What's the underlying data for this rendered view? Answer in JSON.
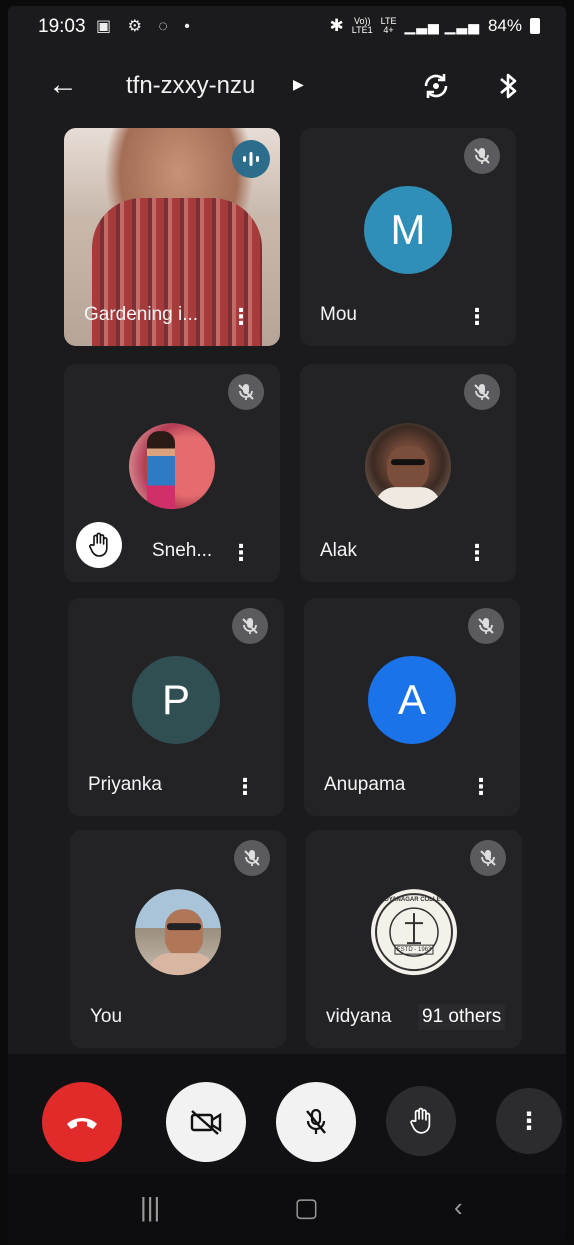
{
  "status_bar": {
    "time": "19:03",
    "net_top": "Vo))",
    "net_bottom": "LTE1",
    "lte_top": "LTE",
    "lte_bottom": "4+",
    "battery": "84%"
  },
  "header": {
    "meeting_code": "tfn-zxxy-nzu"
  },
  "participants": [
    {
      "name": "Gardening i...",
      "type": "video"
    },
    {
      "name": "Mou",
      "initial": "M",
      "color": "#2f8fb8"
    },
    {
      "name": "Sneh...",
      "type": "photo",
      "hand_raised": true
    },
    {
      "name": "Alak",
      "type": "photo"
    },
    {
      "name": "Priyanka",
      "initial": "P",
      "color": "#2f4f52"
    },
    {
      "name": "Anupama",
      "initial": "A",
      "color": "#1a73e8"
    },
    {
      "name": "You",
      "type": "photo"
    },
    {
      "name": "vidyana",
      "type": "logo",
      "logo_text_top": "VIDYANAGAR COLLEGE",
      "logo_text_mid": "ESTD - 1963"
    }
  ],
  "others_label": "91 others",
  "colors": {
    "end_call": "#e12b2b",
    "mute_badge": "#5b5b5f"
  }
}
